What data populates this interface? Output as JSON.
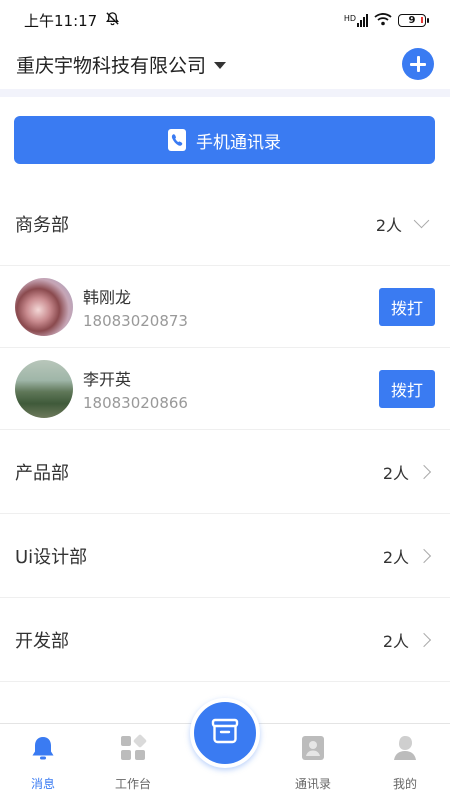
{
  "status_bar": {
    "time": "上午11:17",
    "battery_level": "9",
    "network_label": "HD"
  },
  "header": {
    "company_name": "重庆宇物科技有限公司"
  },
  "contacts_button": {
    "label": "手机通讯录"
  },
  "departments": [
    {
      "name": "商务部",
      "count": "2人",
      "expanded": true
    },
    {
      "name": "产品部",
      "count": "2人",
      "expanded": false
    },
    {
      "name": "Ui设计部",
      "count": "2人",
      "expanded": false
    },
    {
      "name": "开发部",
      "count": "2人",
      "expanded": false
    }
  ],
  "members": [
    {
      "name": "韩刚龙",
      "phone": "18083020873",
      "call_label": "拨打"
    },
    {
      "name": "李开英",
      "phone": "18083020866",
      "call_label": "拨打"
    }
  ],
  "bottom_nav": {
    "items": [
      {
        "label": "消息",
        "icon": "bell-icon",
        "active": true
      },
      {
        "label": "工作台",
        "icon": "grid-icon",
        "active": false
      },
      {
        "label": "通讯录",
        "icon": "contact-card-icon",
        "active": false
      },
      {
        "label": "我的",
        "icon": "person-icon",
        "active": false
      }
    ],
    "center_icon": "basket-icon"
  },
  "colors": {
    "accent": "#3a7bf2",
    "band": "#f2f3fb"
  }
}
